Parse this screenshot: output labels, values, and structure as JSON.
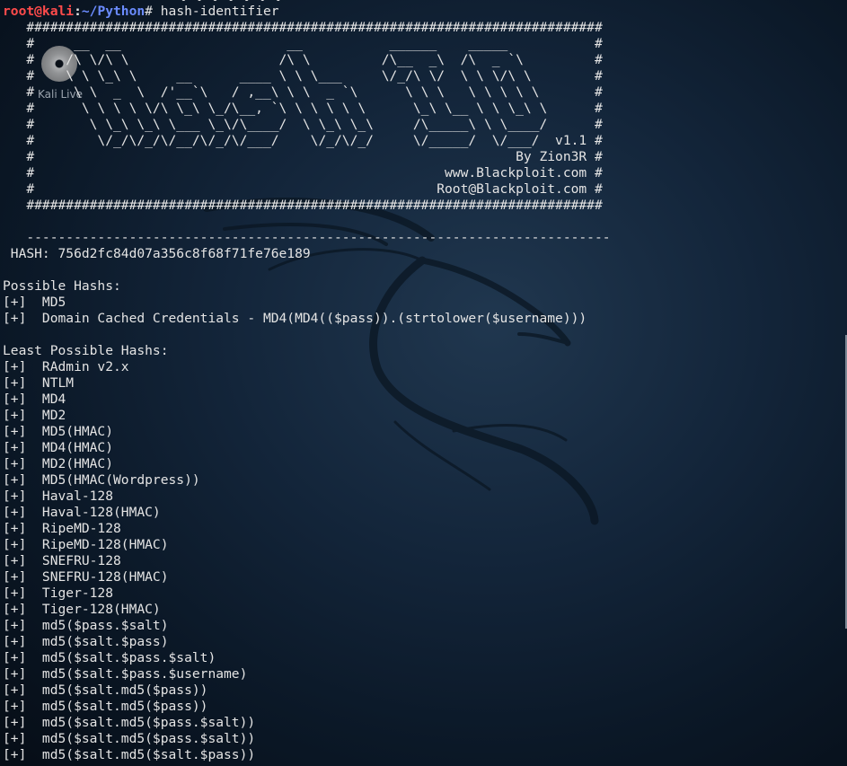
{
  "prompt": {
    "user_host": "root@kali",
    "separator": ":",
    "path": "~/Python",
    "symbol": "#",
    "command": " hash-identifier"
  },
  "partial_top_text": "• • • • • • •",
  "banner_lines": [
    "   #########################################################################",
    "   #     __  __                     __           ______    _____           #",
    "   #    /\\ \\/\\ \\                   /\\ \\         /\\__  _\\  /\\  _ `\\         #",
    "   #    \\ \\ \\_\\ \\     __      ____ \\ \\ \\___     \\/_/\\ \\/  \\ \\ \\/\\ \\        #",
    "   #     \\ \\  _  \\  /'__`\\   / ,__\\ \\ \\  _ `\\      \\ \\ \\   \\ \\ \\ \\ \\       #",
    "   #      \\ \\ \\ \\ \\/\\ \\_\\ \\_/\\__, `\\ \\ \\ \\ \\ \\      \\_\\ \\__ \\ \\ \\_\\ \\      #",
    "   #       \\ \\_\\ \\_\\ \\___ \\_\\/\\____/  \\ \\_\\ \\_\\     /\\_____\\ \\ \\____/      #",
    "   #        \\/_/\\/_/\\/__/\\/_/\\/___/    \\/_/\\/_/     \\/_____/  \\/___/  v1.1 #",
    "   #                                                             By Zion3R #",
    "   #                                                    www.Blackploit.com #",
    "   #                                                   Root@Blackploit.com #",
    "   #########################################################################"
  ],
  "divider": "   --------------------------------------------------------------------------",
  "hash_line": " HASH: 756d2fc84d07a356c8f68f71fe76e189",
  "possible": {
    "heading": "Possible Hashs:",
    "items": [
      "[+]  MD5",
      "[+]  Domain Cached Credentials - MD4(MD4(($pass)).(strtolower($username)))"
    ]
  },
  "least_possible": {
    "heading": "Least Possible Hashs:",
    "items": [
      "[+]  RAdmin v2.x",
      "[+]  NTLM",
      "[+]  MD4",
      "[+]  MD2",
      "[+]  MD5(HMAC)",
      "[+]  MD4(HMAC)",
      "[+]  MD2(HMAC)",
      "[+]  MD5(HMAC(Wordpress))",
      "[+]  Haval-128",
      "[+]  Haval-128(HMAC)",
      "[+]  RipeMD-128",
      "[+]  RipeMD-128(HMAC)",
      "[+]  SNEFRU-128",
      "[+]  SNEFRU-128(HMAC)",
      "[+]  Tiger-128",
      "[+]  Tiger-128(HMAC)",
      "[+]  md5($pass.$salt)",
      "[+]  md5($salt.$pass)",
      "[+]  md5($salt.$pass.$salt)",
      "[+]  md5($salt.$pass.$username)",
      "[+]  md5($salt.md5($pass))",
      "[+]  md5($salt.md5($pass))",
      "[+]  md5($salt.md5($pass.$salt))",
      "[+]  md5($salt.md5($pass.$salt))",
      "[+]  md5($salt.md5($salt.$pass))"
    ]
  },
  "desktop_icon": {
    "name": "cd-icon",
    "label": "Kali Live"
  },
  "colors": {
    "prompt_user": "#ff4b4b",
    "prompt_path": "#6b8cff",
    "text": "#e4e4e4",
    "background": "#13253a"
  }
}
